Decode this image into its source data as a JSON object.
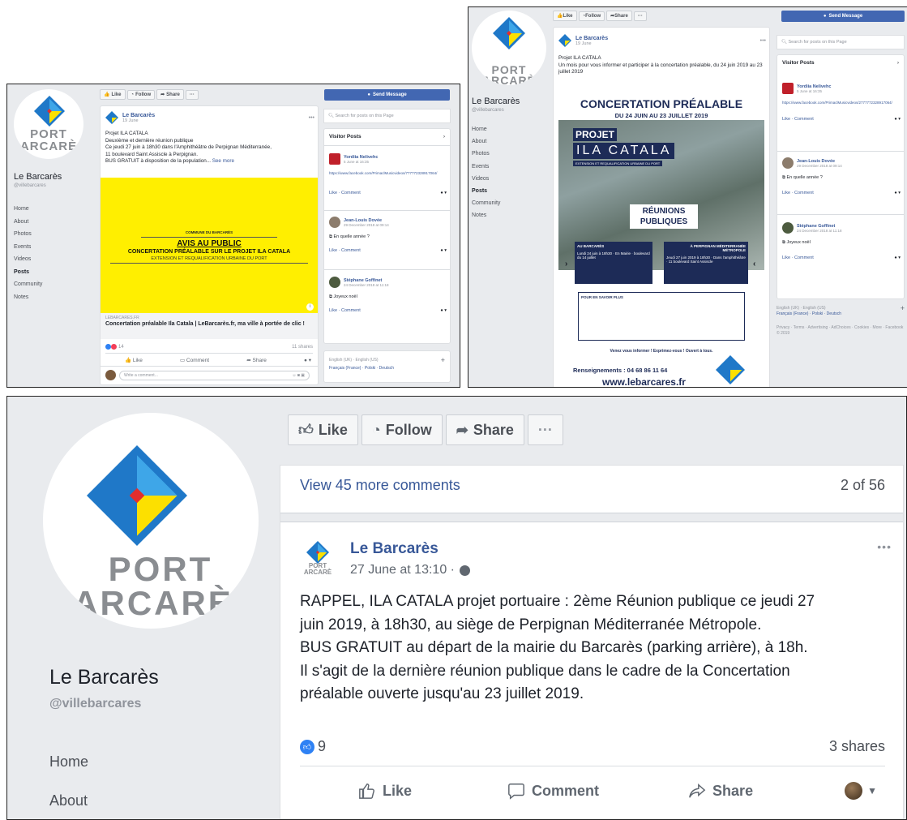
{
  "page": {
    "name": "Le Barcarès",
    "handle": "@villebarcares",
    "logo_text_top": "PORT",
    "logo_text_bottom": "ARCARÈ",
    "logo_text_bottom_wide": "BARCARÈ"
  },
  "colors": {
    "fb_blue": "#4267b2",
    "yellow": "#ffef00",
    "navy": "#1d2b57",
    "logo_blue": "#1f78c8"
  },
  "actions": {
    "like": "Like",
    "follow": "Follow",
    "share": "Share",
    "more": "···",
    "send_message": "Send Message"
  },
  "nav": {
    "home": "Home",
    "about": "About",
    "photos": "Photos",
    "events": "Events",
    "videos": "Videos",
    "posts": "Posts",
    "community": "Community",
    "notes": "Notes"
  },
  "search": {
    "placeholder": "Search for posts on this Page"
  },
  "visitor_posts": {
    "title": "Visitor Posts",
    "items": [
      {
        "name": "Yordiia Nelivehc",
        "time_s1": "5 June at 16:35",
        "time_s2": "5 June at 16:35",
        "link_s1": "https://www.facebook.com/PrimaclMusicvideos/777772328917064/",
        "link_s2": "https://www.facebook.com/PrimaclMusicvideos/2777772328917064/",
        "actions": "Like · Comment"
      },
      {
        "name_s1": "Jean-Louis Dovée",
        "name_s2": "Jean-Louis Dovée",
        "time": "29 December 2018 at 09:14",
        "text": "En quelle année ?",
        "actions": "Like · Comment"
      },
      {
        "name": "Stéphane Goffinet",
        "time_s1": "24 December 2018 at 11:18",
        "time_s2": "24 December 2018 at 11:18",
        "text": "Joyeux noël",
        "actions": "Like · Comment"
      }
    ]
  },
  "footer_langs": {
    "s1": "English (UK) · English (US)",
    "s1b": "Français (France) · Polski · Deutsch",
    "s2": "English (UK) · English (US)",
    "s2b": "Français (France) · Polski · Deutsch",
    "s2c": "Privacy · Terms · Advertising · AdChoices · Cookies · More · Facebook © 2019"
  },
  "post1": {
    "author": "Le Barcarès",
    "time": "19 June",
    "lines": [
      "Projet ILA CATALA",
      "Deuxième et dernière réunion publique",
      "Ce jeudi 27 juin à 18h30 dans l'Amphithéâtre de Perpignan Méditerranée,",
      "11 boulevard Saint Assiscle à Perpignan.",
      "BUS GRATUIT à disposition de la population..."
    ],
    "see_more": "See more",
    "banner_commune": "COMMUNE DU BARCARÈS",
    "banner_avis": "AVIS AU PUBLIC",
    "banner_line1": "CONCERTATION PRÉALABLE SUR LE PROJET ILA CATALA",
    "banner_line2": "EXTENSION ET REQUALIFICATION URBAINE DU PORT",
    "link_domain": "LEBARCARES.FR",
    "link_title": "Concertation préalable Ila Catala | LeBarcarès.fr, ma ville à portée de clic !",
    "reactions": "14",
    "shares": "11 shares",
    "comment_label": "Comment",
    "write_comment": "Write a comment..."
  },
  "post2": {
    "author": "Le Barcarès",
    "time": "19 June",
    "line1": "Projet ILA CATALA",
    "line2": "Un mois pour vous informer et participer à la concertation préalable, du 24 juin 2019 au 23 juillet 2019",
    "poster_title": "CONCERTATION PRÉALABLE",
    "poster_dates": "DU 24 JUIN AU 23 JUILLET 2019",
    "poster_projet": "PROJET",
    "poster_name": "ILA CATALA",
    "poster_sub": "EXTENSION ET REQUALIFICATION URBAINE DU PORT",
    "poster_reunions": "RÉUNIONS PUBLIQUES",
    "poster_left_head": "AU BARCARÈS",
    "poster_left_body": "Lundi 24 juin à 18h30 · En Mairie · boulevard du 14 juillet",
    "poster_right_head": "À PERPIGNAN MÉDITERRANÉE MÉTROPOLE",
    "poster_right_body": "Jeudi 27 juin 2019 à 18h30 · Dans l'amphithéâtre · 11 boulevard Saint Assiscle",
    "poster_savoir": "POUR EN SAVOIR PLUS",
    "poster_venez": "Venez vous informer ! Exprimez-vous ! Ouvert à tous.",
    "poster_tel": "Renseignements : 04 68 86 11 64",
    "poster_web": "www.lebarcares.fr"
  },
  "post3": {
    "view_more": "View 45 more comments",
    "count": "2 of 56",
    "author": "Le Barcarès",
    "time": "27 June at 13:10 ·",
    "lines": [
      "RAPPEL, ILA CATALA projet portuaire : 2ème Réunion publique ce jeudi 27",
      "juin 2019, à 18h30, au siège de Perpignan Méditerranée Métropole.",
      "BUS GRATUIT au départ de la mairie du Barcarès (parking arrière), à 18h.",
      "Il s'agit de la dernière réunion publique dans le cadre de la Concertation",
      "préalable ouverte jusqu'au 23 juillet 2019."
    ],
    "reactions": "9",
    "shares": "3 shares",
    "comment_label": "Comment"
  }
}
